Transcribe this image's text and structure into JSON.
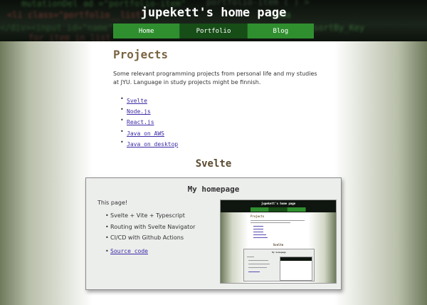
{
  "header": {
    "site_title": "jupekett's home page",
    "nav": [
      {
        "label": "Home",
        "active": false
      },
      {
        "label": "Portfolio",
        "active": true
      },
      {
        "label": "Blog",
        "active": false
      }
    ],
    "colors": {
      "nav_bg": "#2f8f2f",
      "nav_active_bg": "#174d17"
    }
  },
  "main": {
    "title": "Projects",
    "intro": "Some relevant programming projects from personal life and my studies at JYU. Language in study projects might be finnish.",
    "toc": [
      "Svelte",
      "Node.js",
      "React.js",
      "Java on AWS",
      "Java on desktop"
    ],
    "section_title": "Svelte",
    "card": {
      "title": "My homepage",
      "description": "This page!",
      "features": [
        "Svelte + Vite + Typescript",
        "Routing with Svelte Navigator",
        "CI/CD with Github Actions"
      ],
      "source_link": "Source code",
      "screenshot": {
        "site_title": "jupekett's home page",
        "page_title": "Projects",
        "section_title": "Svelte",
        "card_title": "My homepage"
      }
    }
  }
}
